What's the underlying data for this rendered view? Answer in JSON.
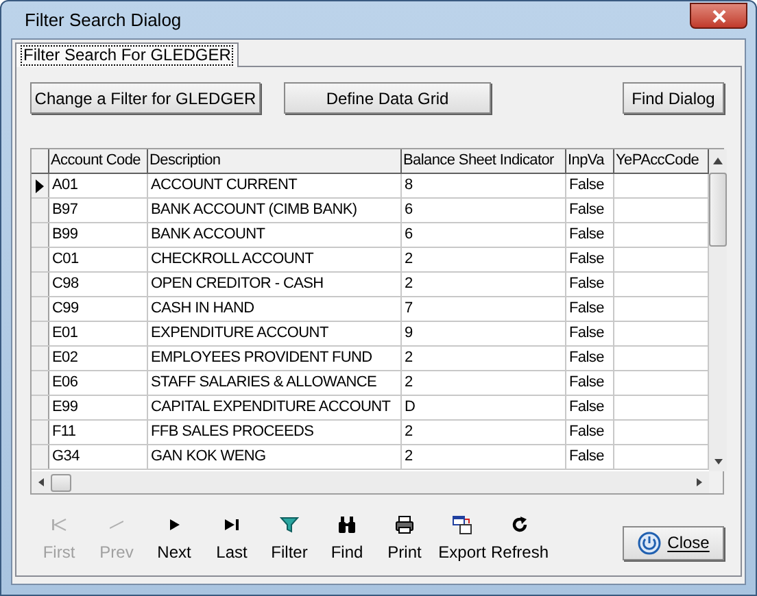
{
  "window": {
    "title": "Filter Search Dialog"
  },
  "tabs": [
    {
      "label": "Filter Search For GLEDGER",
      "selected": true
    }
  ],
  "buttons": [
    {
      "label": "Change a Filter for GLEDGER"
    },
    {
      "label": "Define Data Grid"
    },
    {
      "label": "Find Dialog"
    }
  ],
  "table": {
    "columns": [
      "Account Code",
      "Description",
      "Balance Sheet Indicator",
      "InpVa",
      "YePAccCode"
    ],
    "rows": [
      {
        "current": true,
        "cells": [
          "A01",
          "ACCOUNT CURRENT",
          "8",
          "False",
          ""
        ]
      },
      {
        "current": false,
        "cells": [
          "B97",
          "BANK ACCOUNT (CIMB BANK)",
          "6",
          "False",
          ""
        ]
      },
      {
        "current": false,
        "cells": [
          "B99",
          "BANK ACCOUNT",
          "6",
          "False",
          ""
        ]
      },
      {
        "current": false,
        "cells": [
          "C01",
          "CHECKROLL ACCOUNT",
          "2",
          "False",
          ""
        ]
      },
      {
        "current": false,
        "cells": [
          "C98",
          "OPEN CREDITOR - CASH",
          "2",
          "False",
          ""
        ]
      },
      {
        "current": false,
        "cells": [
          "C99",
          "CASH IN HAND",
          "7",
          "False",
          ""
        ]
      },
      {
        "current": false,
        "cells": [
          "E01",
          "EXPENDITURE ACCOUNT",
          "9",
          "False",
          ""
        ]
      },
      {
        "current": false,
        "cells": [
          "E02",
          "EMPLOYEES PROVIDENT FUND",
          "2",
          "False",
          ""
        ]
      },
      {
        "current": false,
        "cells": [
          "E06",
          "STAFF SALARIES & ALLOWANCE",
          "2",
          "False",
          ""
        ]
      },
      {
        "current": false,
        "cells": [
          "E99",
          "CAPITAL EXPENDITURE ACCOUNT",
          "D",
          "False",
          ""
        ]
      },
      {
        "current": false,
        "cells": [
          "F11",
          "FFB SALES PROCEEDS",
          "2",
          "False",
          ""
        ]
      },
      {
        "current": false,
        "cells": [
          "G34",
          "GAN KOK WENG",
          "2",
          "False",
          ""
        ]
      }
    ]
  },
  "toolbar": [
    {
      "kind": "first",
      "label": "First",
      "disabled": true
    },
    {
      "kind": "prev",
      "label": "Prev",
      "disabled": true
    },
    {
      "kind": "next",
      "label": "Next",
      "disabled": false
    },
    {
      "kind": "last",
      "label": "Last",
      "disabled": false
    },
    {
      "kind": "filter",
      "label": "Filter",
      "disabled": false
    },
    {
      "kind": "find",
      "label": "Find",
      "disabled": false
    },
    {
      "kind": "print",
      "label": "Print",
      "disabled": false
    },
    {
      "kind": "export",
      "label": "Export",
      "disabled": false
    },
    {
      "kind": "refresh",
      "label": "Refresh",
      "disabled": false
    }
  ],
  "close_button": {
    "label": "Close"
  }
}
